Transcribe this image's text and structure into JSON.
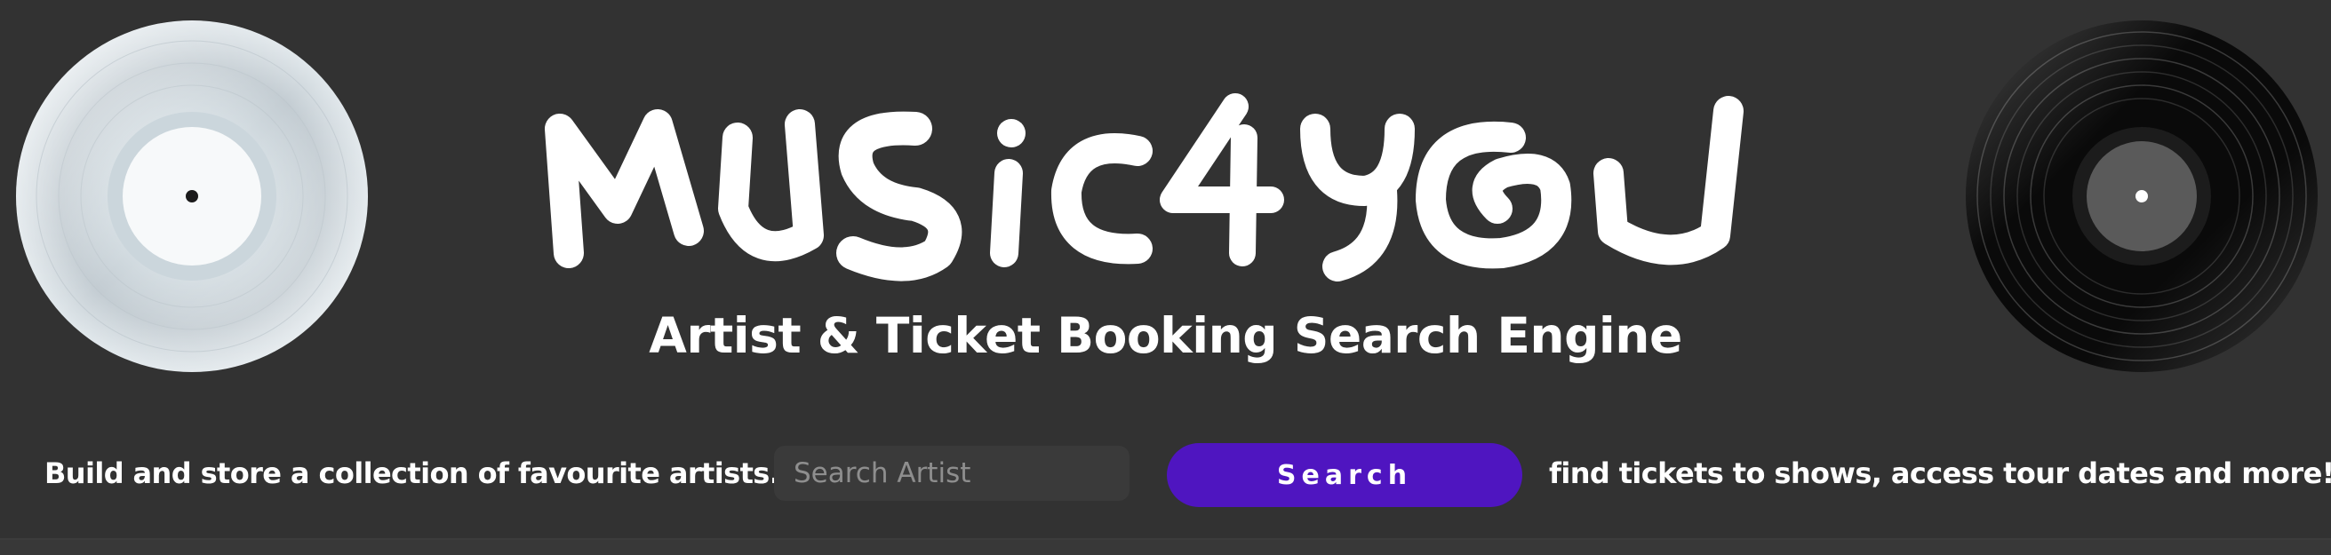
{
  "header": {
    "logo_text": "MUSIC4YOU",
    "subtitle": "Artist & Ticket Booking Search Engine"
  },
  "search": {
    "tagline_left": "Build and store a collection of favourite artists...",
    "placeholder": "Search Artist",
    "value": "",
    "button_label": "Search",
    "tagline_right": "find tickets to shows, access tour dates and more!"
  },
  "icons": {
    "left_disc": "white-vinyl-record-icon",
    "right_disc": "black-vinyl-record-icon"
  },
  "colors": {
    "background": "#323232",
    "accent": "#4f15c0",
    "text": "#ffffff"
  }
}
